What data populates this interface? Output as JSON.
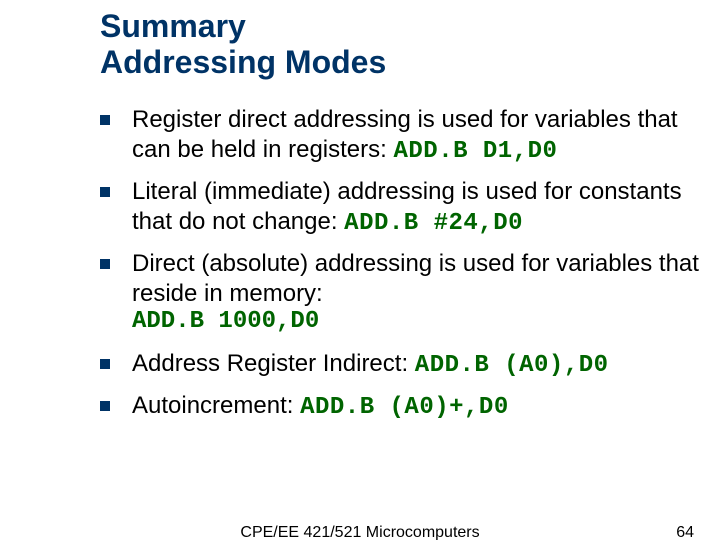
{
  "title_line1": "Summary",
  "title_line2": "Addressing Modes",
  "bullets": [
    {
      "text": "Register direct addressing is used for variables that can be held in registers: ",
      "code": "ADD.B D1,D0"
    },
    {
      "text": "Literal (immediate) addressing is used for constants that do not change: ",
      "code": "ADD.B #24,D0"
    },
    {
      "text": "Direct (absolute) addressing is used for variables that reside in memory:",
      "code": "",
      "code_below": "ADD.B 1000,D0"
    },
    {
      "text": "Address Register Indirect: ",
      "code": "ADD.B (A0),D0"
    },
    {
      "text": "Autoincrement: ",
      "code": "ADD.B (A0)+,D0"
    }
  ],
  "footer_center": "CPE/EE 421/521 Microcomputers",
  "footer_right": "64"
}
